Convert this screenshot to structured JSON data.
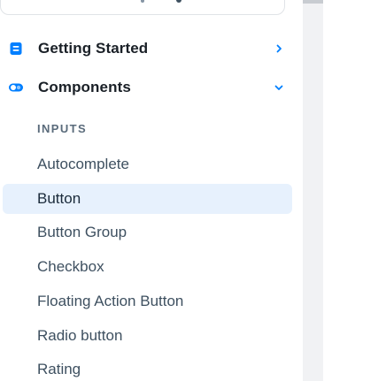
{
  "sidebar": {
    "top_items": [
      {
        "label": "Getting Started",
        "icon": "book-icon",
        "chevron": "chevron-right-icon",
        "expanded": false
      },
      {
        "label": "Components",
        "icon": "toggle-icon",
        "chevron": "chevron-down-icon",
        "expanded": true
      }
    ],
    "section_header": "INPUTS",
    "sub_items": [
      {
        "label": "Autocomplete",
        "active": false
      },
      {
        "label": "Button",
        "active": true
      },
      {
        "label": "Button Group",
        "active": false
      },
      {
        "label": "Checkbox",
        "active": false
      },
      {
        "label": "Floating Action Button",
        "active": false
      },
      {
        "label": "Radio button",
        "active": false
      },
      {
        "label": "Rating",
        "active": false
      }
    ]
  },
  "colors": {
    "accent": "#007fff",
    "active_bg": "#e7f1fd",
    "text_primary": "#1a2027",
    "text_secondary": "#3e5060",
    "section_header": "#5a6b7b"
  }
}
